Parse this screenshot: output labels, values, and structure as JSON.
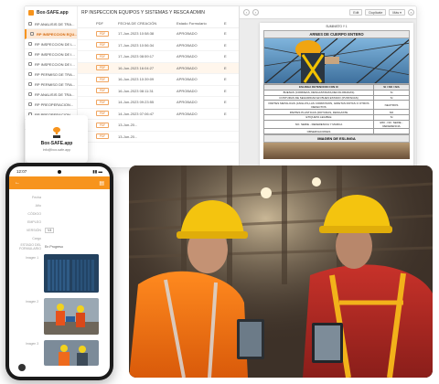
{
  "app": {
    "brand": "Box-SAFE.app",
    "page_title": "RP INSPECCION EQUIPOS Y SISTEMAS Y RESCA ADMIN",
    "sidebar": [
      {
        "label": "RP ANALISIS DE TRA...",
        "active": false
      },
      {
        "label": "RP INSPECCION EQU...",
        "active": true
      },
      {
        "label": "RP INSPECCION DE L...",
        "active": false
      },
      {
        "label": "RP INSPECCION DE I...",
        "active": false
      },
      {
        "label": "RP INSPECCION DE I...",
        "active": false
      },
      {
        "label": "RP PERMISO DE TRA...",
        "active": false
      },
      {
        "label": "RP PERMISO DE TRA...",
        "active": false
      },
      {
        "label": "RP ANALISIS DE TRA...",
        "active": false
      },
      {
        "label": "RP PREOPERACION...",
        "active": false
      },
      {
        "label": "RP PREOPERACION...",
        "active": false
      },
      {
        "label": "RP ANALISIS DE TRA...",
        "active": false
      }
    ],
    "table": {
      "headers": {
        "pdf": "PDF",
        "date": "FECHA DE CREACIÓN",
        "state": "Estado Formulario",
        "extra": "E"
      },
      "rows": [
        {
          "pdf": "PDF",
          "date": "17-Jun-2023 10:58:38",
          "state": "APROBADO",
          "extra": "E",
          "hl": false
        },
        {
          "pdf": "PDF",
          "date": "17-Jun-2023 10:56:34",
          "state": "APROBADO",
          "extra": "E",
          "hl": false
        },
        {
          "pdf": "PDF",
          "date": "17-Jun-2023 08:59:17",
          "state": "APROBADO",
          "extra": "E",
          "hl": false
        },
        {
          "pdf": "PDF",
          "date": "16-Jun-2023 16:04:27",
          "state": "APROBADO",
          "extra": "E",
          "hl": true
        },
        {
          "pdf": "PDF",
          "date": "16-Jun-2023 10:39:09",
          "state": "APROBADO",
          "extra": "E",
          "hl": false
        },
        {
          "pdf": "PDF",
          "date": "16-Jun-2023 08:11:31",
          "state": "APROBADO",
          "extra": "E",
          "hl": false
        },
        {
          "pdf": "PDF",
          "date": "14-Jun-2023 09:23:55",
          "state": "APROBADO",
          "extra": "E",
          "hl": false
        },
        {
          "pdf": "PDF",
          "date": "14-Jun-2023 07:06:47",
          "state": "APROBADO",
          "extra": "E",
          "hl": false
        },
        {
          "pdf": "PDF",
          "date": "13-Jun-20...",
          "state": "",
          "extra": "",
          "hl": false
        },
        {
          "pdf": "PDF",
          "date": "13-Jun-20...",
          "state": "",
          "extra": "",
          "hl": false
        }
      ]
    },
    "viewer": {
      "btn_edit": "Edit",
      "btn_duplicate": "Duplicate",
      "btn_more": "Más",
      "doc_head": "SUMINISTO Y 1",
      "doc_title": "ARNES DE CUERPO ENTERO",
      "table_headers": [
        "ESLINGA DETENCION CON IC",
        "SI / NO / N/A"
      ],
      "table_rows": [
        [
          "BUENAS (CORREAS, DESGASTADAS,DECOLORADAS)",
          "Sí"
        ],
        [
          "COSTURAS DE SEGURIDAD EN BUEN ESTADO (PUNTADAS)",
          "Sí"
        ],
        [
          "PARTES METALICAS (ANILLOS,LAS CORROSION, GRIETAS ROTAS O OTROS DEFECTOS",
          "NEUTROS"
        ],
        [
          "PARTES PLASTICAS (ROTURAS, DESGASTE",
          "NO"
        ],
        [
          "ETIQUETA LEGIBLE",
          "Sí"
        ],
        [
          "NO. SERIE - REFERENCIA Y MARCA",
          "E50 - NO. SERIE - REFERENCIA"
        ],
        [
          "OBSERVACIONES",
          ""
        ]
      ],
      "doc_subtitle": "IMAGEN DE ESLINGA"
    }
  },
  "card": {
    "title": "Box-SAFE.app",
    "subtitle": "info@box-safe.app"
  },
  "phone": {
    "time": "12:07",
    "fields": [
      {
        "label": "Fecha",
        "value": "",
        "box": false
      },
      {
        "label": "Año",
        "value": "",
        "box": false
      },
      {
        "label": "CÓDIGO",
        "value": "",
        "box": false
      },
      {
        "label": "EMPLEO",
        "value": "",
        "box": false
      },
      {
        "label": "VERSIÓN",
        "value": "V4",
        "box": true
      },
      {
        "label": "Cargo",
        "value": "",
        "box": false
      },
      {
        "label": "ESTADO DEL FORMULARIO",
        "value": "En Progreso",
        "box": false
      }
    ],
    "image_labels": [
      "Imagen 1",
      "Imagen 2",
      "Imagen 3"
    ]
  }
}
